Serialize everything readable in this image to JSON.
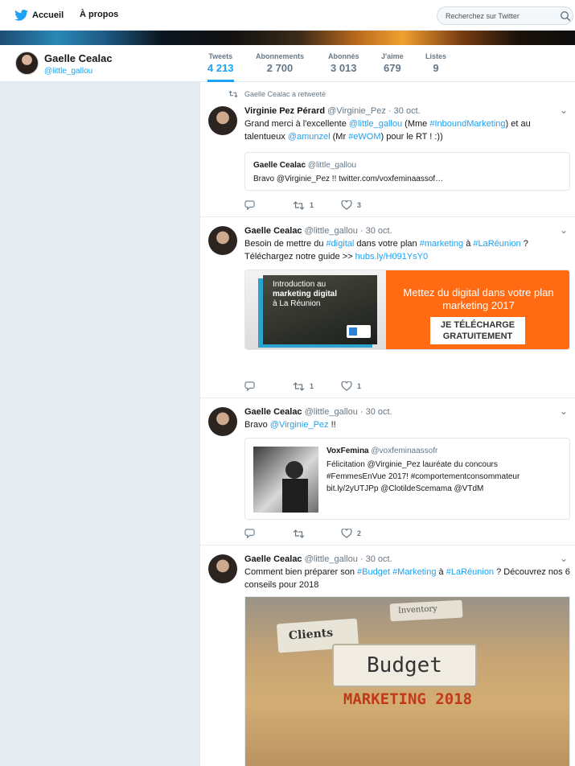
{
  "nav": {
    "home": "Accueil",
    "about": "À propos",
    "search_placeholder": "Recherchez sur Twitter"
  },
  "profile": {
    "name": "Gaelle Cealac",
    "handle": "@little_gallou"
  },
  "stats": [
    {
      "label": "Tweets",
      "value": "4 213"
    },
    {
      "label": "Abonnements",
      "value": "2 700"
    },
    {
      "label": "Abonnés",
      "value": "3 013"
    },
    {
      "label": "J'aime",
      "value": "679"
    },
    {
      "label": "Listes",
      "value": "9"
    }
  ],
  "tweets": [
    {
      "retweet_note": "Gaelle Cealac a retweeté",
      "author": "Virginie Pez Pérard",
      "handle": "@Virginie_Pez",
      "date": "· 30 oct.",
      "text_parts": [
        "Grand merci à l'excellente ",
        "@little_gallou",
        " (Mme ",
        "#InboundMarketing",
        ") et au talentueux ",
        "@amunzel",
        " (Mr ",
        "#eWOM",
        ") pour le RT ! :))"
      ],
      "quote": {
        "author": "Gaelle Cealac",
        "handle": "@little_gallou",
        "text": "Bravo @Virginie_Pez !! twitter.com/voxfeminaassof…"
      },
      "retweets": "1",
      "likes": "3"
    },
    {
      "author": "Gaelle Cealac",
      "handle": "@little_gallou",
      "date": "· 30 oct.",
      "text_parts": [
        "Besoin de mettre du ",
        "#digital",
        " dans votre plan ",
        "#marketing",
        " à ",
        "#LaRéunion",
        " ?",
        "Téléchargez  notre guide >> ",
        "hubs.ly/H091YsY0"
      ],
      "card": {
        "book_title_1": "Introduction au",
        "book_title_2": "marketing digital",
        "book_title_3": "à La Réunion",
        "headline": "Mettez du digital dans votre plan marketing 2017",
        "cta": "JE TÉLÉCHARGE GRATUITEMENT"
      },
      "retweets": "1",
      "likes": "1"
    },
    {
      "author": "Gaelle Cealac",
      "handle": "@little_gallou",
      "date": "· 30 oct.",
      "text_parts": [
        "Bravo ",
        "@Virginie_Pez",
        " !!"
      ],
      "quote": {
        "author": "VoxFemina",
        "handle": "@voxfeminaassofr",
        "text": "Félicitation @Virginie_Pez lauréate du concours #FemmesEnVue 2017! #comportementconsommateur bit.ly/2yUTJPp @ClotildeScemama @VTdM"
      },
      "retweets": "",
      "likes": "2"
    },
    {
      "author": "Gaelle Cealac",
      "handle": "@little_gallou",
      "date": "· 30 oct.",
      "text_parts": [
        "Comment bien préparer son ",
        "#Budget",
        " ",
        "#Marketing",
        " à ",
        "#LaRéunion",
        " ? Découvrez nos 6 conseils pour 2018"
      ],
      "image": {
        "tab1": "Clients",
        "tab2": "Inventory",
        "label": "Budget",
        "caption": "MARKETING 2018"
      }
    }
  ],
  "colors": {
    "accent": "#1da1f2",
    "cta_orange": "#ff6a13",
    "text": "#14171a",
    "muted": "#657786"
  }
}
